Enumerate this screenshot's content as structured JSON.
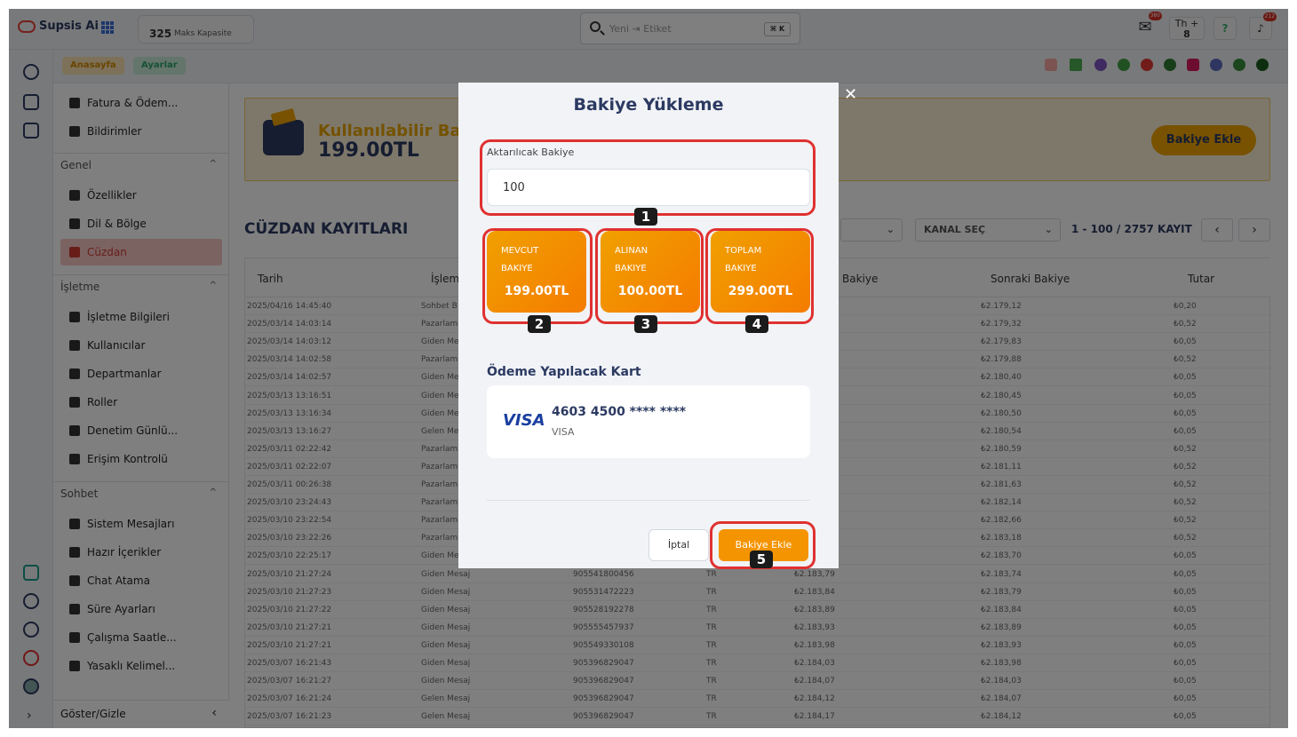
{
  "app": {
    "name": "Supsis Ai"
  },
  "capacity": {
    "value": "325",
    "label": "Maks Kapasite"
  },
  "search": {
    "placeholder": "Yeni ⇥ Etiket",
    "shortcut": "⌘ K"
  },
  "topbar": {
    "mail_badge": "380",
    "user_initials": "Th",
    "user_count": "8",
    "notif_badge": "212"
  },
  "breadcrumb": {
    "home": "Anasayfa",
    "current": "Ayarlar"
  },
  "sidebar": {
    "top_items": [
      {
        "label": "Fatura & Ödem..."
      },
      {
        "label": "Bildirimler"
      }
    ],
    "groups": [
      {
        "title": "Genel",
        "items": [
          {
            "label": "Özellikler"
          },
          {
            "label": "Dil & Bölge"
          },
          {
            "label": "Cüzdan"
          }
        ]
      },
      {
        "title": "İşletme",
        "items": [
          {
            "label": "İşletme Bilgileri"
          },
          {
            "label": "Kullanıcılar"
          },
          {
            "label": "Departmanlar"
          },
          {
            "label": "Roller"
          },
          {
            "label": "Denetim Günlü..."
          },
          {
            "label": "Erişim Kontrolü"
          }
        ]
      },
      {
        "title": "Sohbet",
        "items": [
          {
            "label": "Sistem Mesajları"
          },
          {
            "label": "Hazır İçerikler"
          },
          {
            "label": "Chat Atama"
          },
          {
            "label": "Süre Ayarları"
          },
          {
            "label": "Çalışma Saatle..."
          },
          {
            "label": "Yasaklı Kelimel..."
          }
        ]
      }
    ],
    "footer": "Göster/Gizle"
  },
  "banner": {
    "label": "Kullanılabilir Bak",
    "value": "199.00TL",
    "button": "Bakiye Ekle"
  },
  "wallet": {
    "title": "CÜZDAN KAYITLARI",
    "channel_select": "KANAL SEÇ",
    "page_info": "1 - 100 / 2757 KAYIT",
    "columns": {
      "date": "Tarih",
      "type": "İşlem",
      "prev": "Bakiye",
      "next": "Sonraki Bakiye",
      "amount": "Tutar"
    },
    "rows": [
      {
        "date": "2025/04/16 14:45:40",
        "type": "Sohbet B",
        "phone": "",
        "country": "",
        "prev": "",
        "next": "₺2.179,12",
        "amount": "₺0,20"
      },
      {
        "date": "2025/03/14 14:03:14",
        "type": "Pazarlam",
        "phone": "",
        "country": "",
        "prev": "",
        "next": "₺2.179,32",
        "amount": "₺0,52"
      },
      {
        "date": "2025/03/14 14:03:12",
        "type": "Giden Me",
        "phone": "",
        "country": "",
        "prev": "",
        "next": "₺2.179,83",
        "amount": "₺0,05"
      },
      {
        "date": "2025/03/14 14:02:58",
        "type": "Pazarlam",
        "phone": "",
        "country": "",
        "prev": "",
        "next": "₺2.179,88",
        "amount": "₺0,52"
      },
      {
        "date": "2025/03/14 14:02:57",
        "type": "Giden Me",
        "phone": "",
        "country": "",
        "prev": "",
        "next": "₺2.180,40",
        "amount": "₺0,05"
      },
      {
        "date": "2025/03/13 13:16:51",
        "type": "Giden Me",
        "phone": "",
        "country": "",
        "prev": "",
        "next": "₺2.180,45",
        "amount": "₺0,05"
      },
      {
        "date": "2025/03/13 13:16:34",
        "type": "Giden Me",
        "phone": "",
        "country": "",
        "prev": "",
        "next": "₺2.180,50",
        "amount": "₺0,05"
      },
      {
        "date": "2025/03/13 13:16:27",
        "type": "Gelen Me",
        "phone": "",
        "country": "",
        "prev": "",
        "next": "₺2.180,54",
        "amount": "₺0,05"
      },
      {
        "date": "2025/03/11 02:22:42",
        "type": "Pazarlam",
        "phone": "",
        "country": "",
        "prev": "",
        "next": "₺2.180,59",
        "amount": "₺0,52"
      },
      {
        "date": "2025/03/11 02:22:07",
        "type": "Pazarlam",
        "phone": "",
        "country": "",
        "prev": "",
        "next": "₺2.181,11",
        "amount": "₺0,52"
      },
      {
        "date": "2025/03/11 00:26:38",
        "type": "Pazarlam",
        "phone": "",
        "country": "",
        "prev": "",
        "next": "₺2.181,63",
        "amount": "₺0,52"
      },
      {
        "date": "2025/03/10 23:24:43",
        "type": "Pazarlam",
        "phone": "",
        "country": "",
        "prev": "",
        "next": "₺2.182,14",
        "amount": "₺0,52"
      },
      {
        "date": "2025/03/10 23:22:54",
        "type": "Pazarlam",
        "phone": "",
        "country": "",
        "prev": "",
        "next": "₺2.182,66",
        "amount": "₺0,52"
      },
      {
        "date": "2025/03/10 23:22:26",
        "type": "Pazarlam",
        "phone": "",
        "country": "",
        "prev": "",
        "next": "₺2.183,18",
        "amount": "₺0,52"
      },
      {
        "date": "2025/03/10 22:25:17",
        "type": "Giden Me",
        "phone": "",
        "country": "",
        "prev": "",
        "next": "₺2.183,70",
        "amount": "₺0,05"
      },
      {
        "date": "2025/03/10 21:27:24",
        "type": "Giden Mesaj",
        "phone": "905541800456",
        "country": "TR",
        "prev": "₺2.183,79",
        "next": "₺2.183,74",
        "amount": "₺0,05"
      },
      {
        "date": "2025/03/10 21:27:23",
        "type": "Giden Mesaj",
        "phone": "905531472223",
        "country": "TR",
        "prev": "₺2.183,84",
        "next": "₺2.183,79",
        "amount": "₺0,05"
      },
      {
        "date": "2025/03/10 21:27:22",
        "type": "Giden Mesaj",
        "phone": "905528192278",
        "country": "TR",
        "prev": "₺2.183,89",
        "next": "₺2.183,84",
        "amount": "₺0,05"
      },
      {
        "date": "2025/03/10 21:27:21",
        "type": "Giden Mesaj",
        "phone": "905555457937",
        "country": "TR",
        "prev": "₺2.183,93",
        "next": "₺2.183,89",
        "amount": "₺0,05"
      },
      {
        "date": "2025/03/10 21:27:21",
        "type": "Giden Mesaj",
        "phone": "905549330108",
        "country": "TR",
        "prev": "₺2.183,98",
        "next": "₺2.183,93",
        "amount": "₺0,05"
      },
      {
        "date": "2025/03/07 16:21:43",
        "type": "Giden Mesaj",
        "phone": "905396829047",
        "country": "TR",
        "prev": "₺2.184,03",
        "next": "₺2.183,98",
        "amount": "₺0,05"
      },
      {
        "date": "2025/03/07 16:21:27",
        "type": "Giden Mesaj",
        "phone": "905396829047",
        "country": "TR",
        "prev": "₺2.184,07",
        "next": "₺2.184,03",
        "amount": "₺0,05"
      },
      {
        "date": "2025/03/07 16:21:24",
        "type": "Gelen Mesaj",
        "phone": "905396829047",
        "country": "TR",
        "prev": "₺2.184,12",
        "next": "₺2.184,07",
        "amount": "₺0,05"
      },
      {
        "date": "2025/03/07 16:21:23",
        "type": "Gelen Mesaj",
        "phone": "905396829047",
        "country": "TR",
        "prev": "₺2.184,17",
        "next": "₺2.184,12",
        "amount": "₺0,05"
      }
    ]
  },
  "modal": {
    "title": "Bakiye Yükleme",
    "amount_label": "Aktarılıcak Bakiye",
    "amount_value": "100",
    "cards": [
      {
        "line1": "MEVCUT",
        "line2": "BAKIYE",
        "value": "199.00TL"
      },
      {
        "line1": "ALINAN",
        "line2": "BAKIYE",
        "value": "100.00TL"
      },
      {
        "line1": "TOPLAM",
        "line2": "BAKIYE",
        "value": "299.00TL"
      }
    ],
    "pay_label": "Ödeme Yapılacak Kart",
    "card_brand": "VISA",
    "card_number": "4603 4500 **** ****",
    "card_type": "VISA",
    "cancel": "İptal",
    "confirm": "Bakiye Ekle"
  },
  "annotations": [
    "1",
    "2",
    "3",
    "4",
    "5"
  ],
  "colors": {
    "accent": "#f49400",
    "highlight": "#e03131",
    "brand": "#2c3a62"
  }
}
